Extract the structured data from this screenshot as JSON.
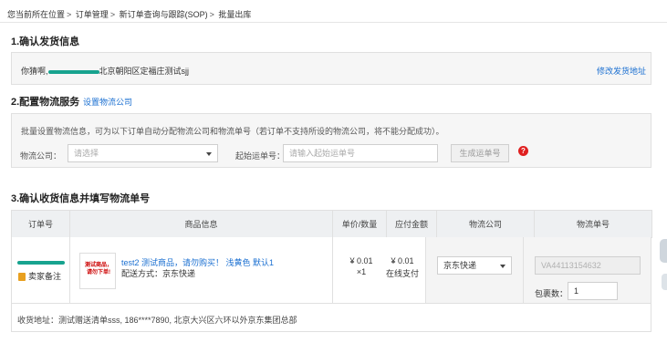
{
  "breadcrumb": [
    "您当前所在位置",
    "订单管理",
    "新订单查询与跟踪(SOP)",
    "批量出库"
  ],
  "section1": {
    "title": "1.确认发货信息",
    "address_prefix": "你猜啊,",
    "address_suffix": "北京朝阳区定福庄测试sjj",
    "edit_link": "修改发货地址"
  },
  "section2": {
    "title": "2.配置物流服务",
    "setup_link": "设置物流公司",
    "desc": "批量设置物流信息，可为以下订单自动分配物流公司和物流单号（若订单不支持所设的物流公司，将不能分配成功）。",
    "company_label": "物流公司：",
    "company_placeholder": "请选择",
    "start_no_label": "起始运单号：",
    "start_no_placeholder": "请输入起始运单号",
    "generate_button": "生成运单号",
    "help": "?"
  },
  "section3": {
    "title": "3.确认收货信息并填写物流单号",
    "columns": [
      "订单号",
      "商品信息",
      "单价/数量",
      "应付金额",
      "物流公司",
      "物流单号"
    ],
    "order": {
      "seller_note": "卖家备注",
      "product_name": "test2 测试商品，请勿购买！ 浅黄色 默认1",
      "shipping_method": "配送方式：京东快递",
      "thumb_text": "测试商品，请勿下单!",
      "unit_price": "¥ 0.01",
      "quantity": "×1",
      "payable": "¥ 0.01",
      "pay_type": "在线支付",
      "carrier": "京东快递",
      "waybill_no": "VA44113154632",
      "package_label": "包裹数：",
      "package_count": "1",
      "recipient": "收货地址：测试赠送清单sss, 186****7890, 北京大兴区六环以外京东集团总部"
    }
  },
  "colors": {
    "link": "#1a6fd1",
    "redaction": "#17a38f",
    "help": "#e02020"
  }
}
